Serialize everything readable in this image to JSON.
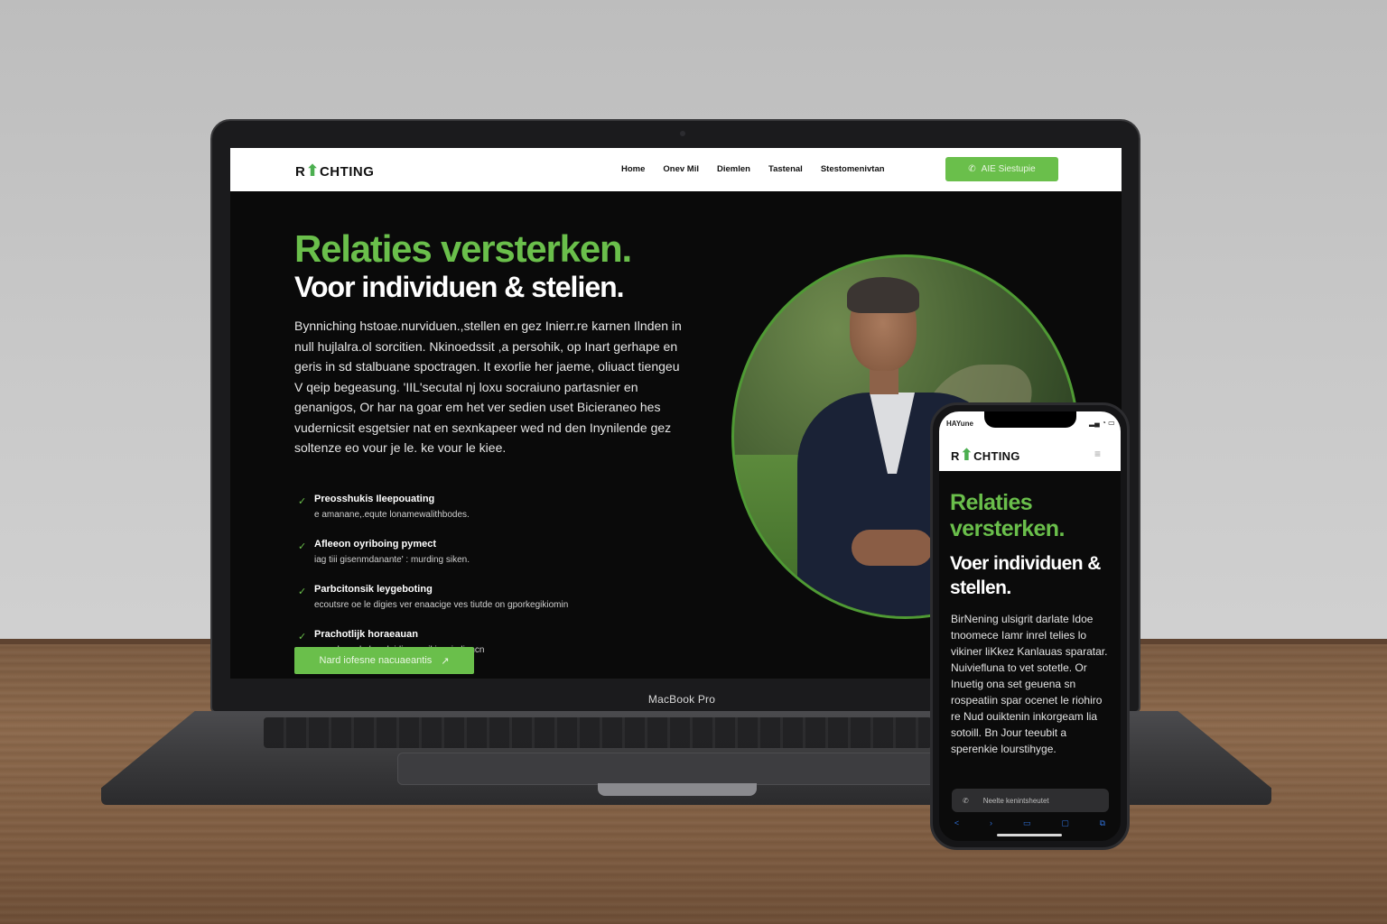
{
  "laptop": {
    "label": "MacBook Pro"
  },
  "site": {
    "logo": {
      "pre": "R",
      "post": "CHTING"
    },
    "nav": {
      "links": [
        "Home",
        "Onev Mil",
        "Diemlen",
        "Tastenal",
        "Stestomenivtan"
      ],
      "cta_label": "AIE Siestupie"
    },
    "hero": {
      "title": "Relaties versterken.",
      "subtitle": "Voor individuen & stelien.",
      "body": "Bynniching hstoae.nurviduen.,stellen en gez Inierr.re karnen Ilnden in null hujlalra.ol sorcitien. Nkinoedssit ,a persohik, op Inart gerhape en geris in sd stalbuane spoctragen. It exorlie her jaeme, oliuact tiengeu V qeip begeasung. 'IIL'secutal nj loxu socraiuno partasnier en genanigos,  Or har na goar em het ver sedien uset Bicieraneo hes vudernicsit esgetsier nat en sexnkapeer wed nd den Inynilende gez soltenze eo vour je le. ke vour le kiee.",
      "cta_label": "Nard iofesne nacuaeantis",
      "features": [
        {
          "title": "Preosshukis Ileepouating",
          "desc": "e amanane,.equte lonamewalithbodes."
        },
        {
          "title": "Afleeon oyriboing pymect",
          "desc": "iag tiii gisenmdanante' : murding siken."
        },
        {
          "title": "Parbcitonsik leygeboting",
          "desc": "ecoutsre oe le digies ver enaacige ves tiutde on gporkegikiomin"
        },
        {
          "title": "Prachotlijk horaeauan",
          "desc": "egandungel abeadeidien on ikiasnie liencn"
        }
      ]
    }
  },
  "phone": {
    "status_time": "HAYune",
    "logo": {
      "pre": "R",
      "post": "CHTING"
    },
    "title": "Relaties versterken.",
    "subtitle": "Voer individuen & stellen.",
    "body": "BirNening ulsigrit darlate Idoe tnoomece Iamr inrel telies lo vikiner liKkez Kanlauas sparatar. Nuiviefluna to vet sotetle.  Or Inuetig ona set geuena sn rospeatiin spar ocenet le riohiro re Nud ouiktenin inkorgeam lia sotoill. Bn Jour teeubit a sperenkie lourstihyge.",
    "cta_label": "Neelte kenintsheutet"
  }
}
